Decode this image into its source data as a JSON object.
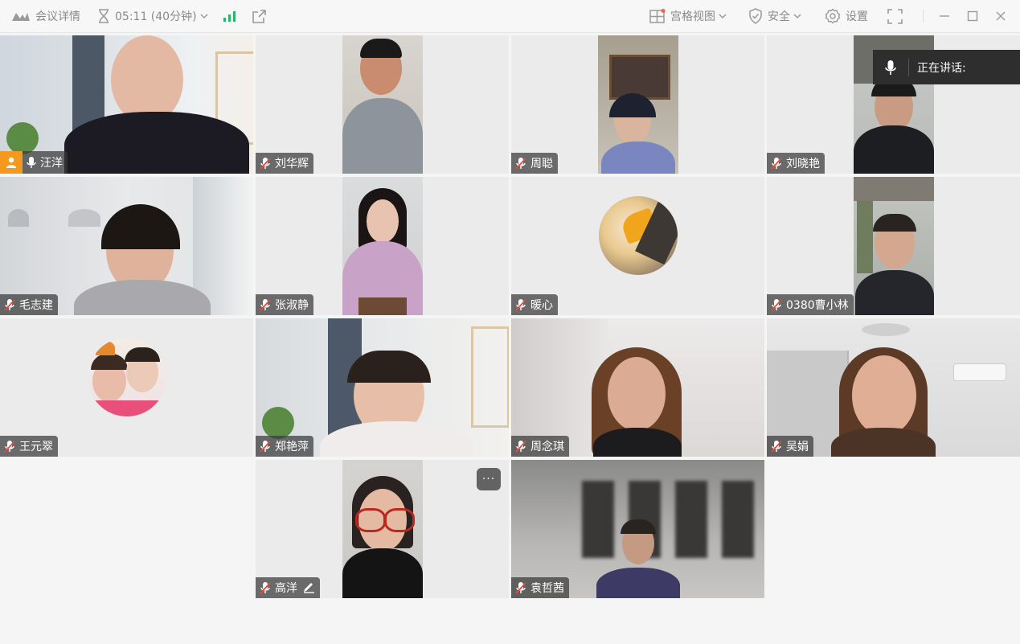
{
  "toolbar": {
    "meeting_details": "会议详情",
    "time": "05:11 (40分钟)",
    "grid_view": "宫格视图",
    "security": "安全",
    "settings": "设置"
  },
  "speaking": {
    "label": "正在讲话:"
  },
  "tiles": [
    {
      "name": "汪洋",
      "host": true
    },
    {
      "name": "刘华辉"
    },
    {
      "name": "周聪"
    },
    {
      "name": "刘晓艳"
    },
    {
      "name": "毛志建"
    },
    {
      "name": "张淑静"
    },
    {
      "name": "暖心"
    },
    {
      "name": "0380曹小林"
    },
    {
      "name": "王元翠"
    },
    {
      "name": "郑艳萍"
    },
    {
      "name": "周念琪"
    },
    {
      "name": "吴娟"
    },
    {
      "name": "高洋",
      "more_label": "···"
    },
    {
      "name": "袁哲茜"
    }
  ],
  "colors": {
    "accent_orange": "#f39a1e",
    "network_green": "#2fb36b",
    "nametag_bg": "#373737",
    "speaking_bg": "#2e2e2e"
  }
}
